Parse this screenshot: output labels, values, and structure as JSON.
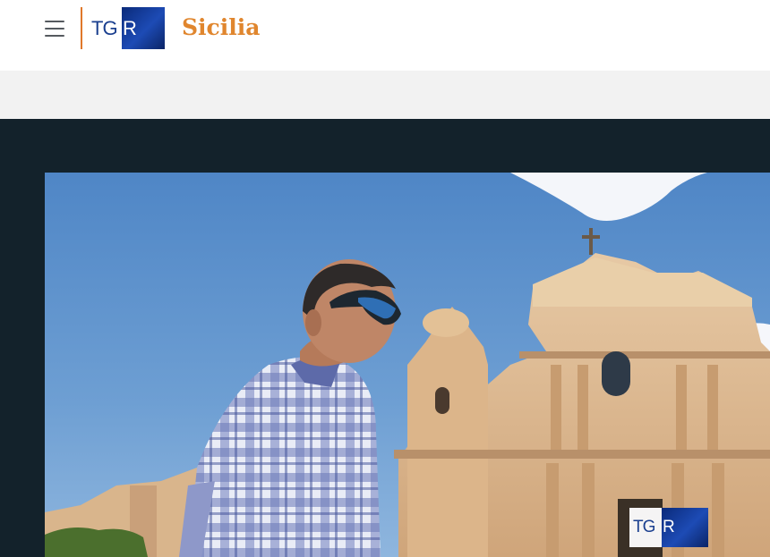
{
  "header": {
    "logo_tg": "TG",
    "logo_r": "R",
    "region": "Sicilia"
  },
  "video": {
    "watermark_tg": "TG",
    "watermark_r": "R"
  },
  "icons": {
    "menu": "hamburger-menu-icon"
  },
  "colors": {
    "accent": "#e0862e",
    "brand_blue": "#1a3f8f",
    "dark_background": "#13222b",
    "band_grey": "#f2f2f2"
  }
}
